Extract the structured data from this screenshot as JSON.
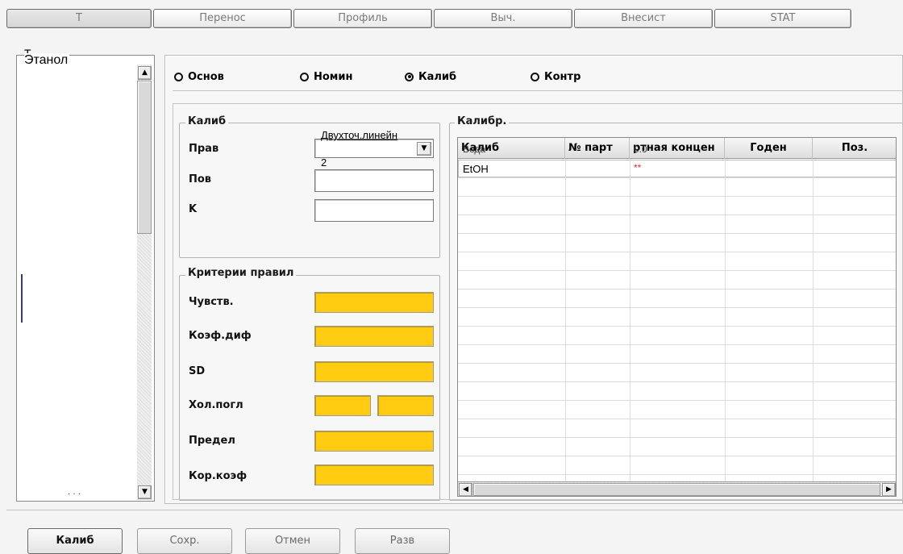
{
  "tabs": [
    "T",
    "Перенос",
    "Профиль",
    "Выч.",
    "Внесист",
    "STAT"
  ],
  "left": {
    "corner": "T",
    "selected_item": "Этанол",
    "bottom_dots": ". . ."
  },
  "modes": [
    {
      "label": "Основ",
      "checked": false
    },
    {
      "label": "Номин",
      "checked": false
    },
    {
      "label": "Калиб",
      "checked": true
    },
    {
      "label": "Контр",
      "checked": false
    }
  ],
  "calib_group": {
    "title": "Калиб",
    "rule_label": "Прав",
    "rule_value_line1": "Двухточ.линейн",
    "rule_value_line2": "2",
    "pov_label": "Пов",
    "k_label": "K"
  },
  "criteria_group": {
    "title": "Критерии правил",
    "items": [
      "Чувств.",
      "Коэф.диф",
      "SD",
      "Хол.погл",
      "Предел",
      "Кор.коэф"
    ]
  },
  "table": {
    "title": "Калибр.",
    "columns": [
      "Калиб",
      "№ парт",
      "ртная концен",
      "Годен",
      "Поз."
    ],
    "overlay_text": "Вода",
    "overlay_value": "0.0",
    "rows": [
      {
        "calib": "EtOH",
        "conc": "**"
      }
    ]
  },
  "buttons": {
    "calib": "Калиб",
    "save": "Сохр.",
    "cancel": "Отмен",
    "expand": "Разв"
  },
  "colors": {
    "criteria_fill": "#ffcc12",
    "accent_red": "#e0303a"
  }
}
